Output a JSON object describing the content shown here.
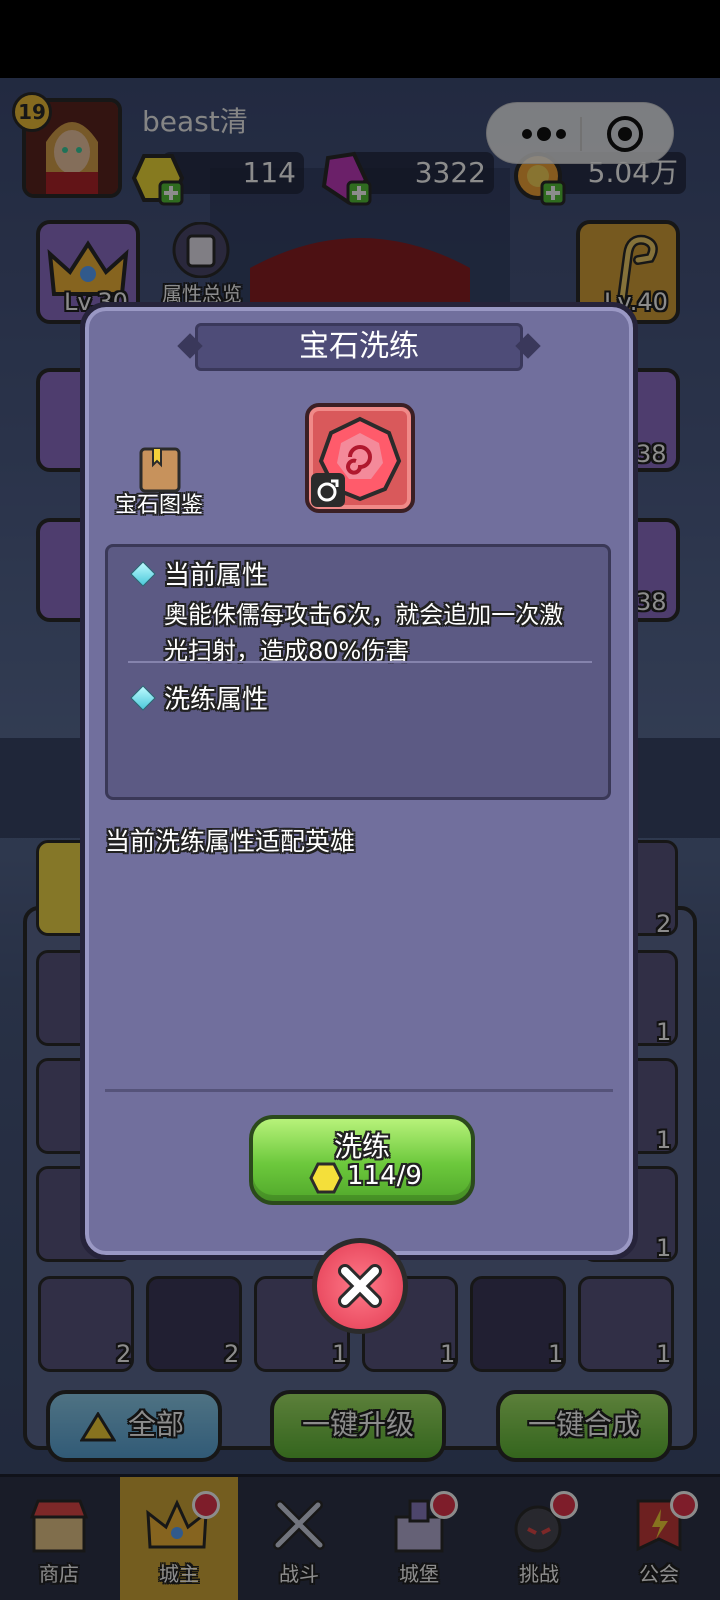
{
  "player": {
    "level": "19",
    "name": "beast清"
  },
  "resources": {
    "gold_gem": "114",
    "purple_gem": "3322",
    "coins": "5.04万"
  },
  "side": {
    "overview_label": "属性总览",
    "crown_level": "Lv.30",
    "staff_level": "Lv.40",
    "right_level_1": "38",
    "right_level_2": "38"
  },
  "modal": {
    "title": "宝石洗练",
    "codex_label": "宝石图鉴",
    "current_attr_heading": "当前属性",
    "current_attr_desc": "奥能侏儒每攻击6次，就会追加一次激光扫射，造成80%伤害",
    "refine_attr_heading": "洗练属性",
    "fit_hint": "当前洗练属性适配英雄",
    "refine_button_label": "洗练",
    "refine_cost": "114/9"
  },
  "gem_counts": [
    "2",
    "2",
    "1",
    "1",
    "1",
    "1"
  ],
  "right_counts": [
    "2",
    "1",
    "1",
    "1"
  ],
  "buttons": {
    "all": "全部",
    "upgrade_all": "一键升级",
    "merge_all": "一键合成"
  },
  "nav": {
    "shop": "商店",
    "lord": "城主",
    "battle": "战斗",
    "castle": "城堡",
    "challenge": "挑战",
    "guild": "公会"
  }
}
